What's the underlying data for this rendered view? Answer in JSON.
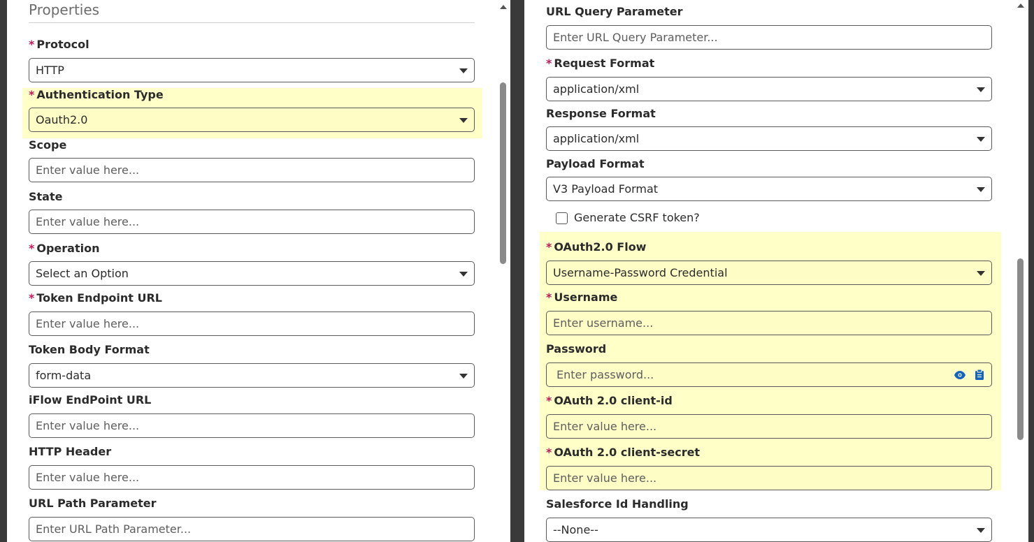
{
  "left": {
    "heading": "Properties",
    "protocol": {
      "label": "Protocol",
      "value": "HTTP"
    },
    "auth_type": {
      "label": "Authentication Type",
      "value": "Oauth2.0"
    },
    "scope": {
      "label": "Scope",
      "placeholder": "Enter value here..."
    },
    "state": {
      "label": "State",
      "placeholder": "Enter value here..."
    },
    "operation": {
      "label": "Operation",
      "value": "Select an Option"
    },
    "token_endpoint": {
      "label": "Token Endpoint URL",
      "placeholder": "Enter value here..."
    },
    "token_body_format": {
      "label": "Token Body Format",
      "value": "form-data"
    },
    "iflow_endpoint": {
      "label": "iFlow EndPoint URL",
      "placeholder": "Enter value here..."
    },
    "http_header": {
      "label": "HTTP Header",
      "placeholder": "Enter value here..."
    },
    "url_path_param": {
      "label": "URL Path Parameter",
      "placeholder": "Enter URL Path Parameter..."
    }
  },
  "right": {
    "url_query_param": {
      "label": "URL Query Parameter",
      "placeholder": "Enter URL Query Parameter..."
    },
    "request_format": {
      "label": "Request Format",
      "value": "application/xml"
    },
    "response_format": {
      "label": "Response Format",
      "value": "application/xml"
    },
    "payload_format": {
      "label": "Payload Format",
      "value": "V3 Payload Format"
    },
    "csrf": {
      "label": "Generate CSRF token?"
    },
    "oauth_flow": {
      "label": "OAuth2.0 Flow",
      "value": "Username-Password Credential"
    },
    "username": {
      "label": "Username",
      "placeholder": "Enter username..."
    },
    "password": {
      "label": "Password",
      "placeholder": "Enter password..."
    },
    "client_id": {
      "label": "OAuth 2.0 client-id",
      "placeholder": "Enter value here..."
    },
    "client_secret": {
      "label": "OAuth 2.0 client-secret",
      "placeholder": "Enter value here..."
    },
    "salesforce_id": {
      "label": "Salesforce Id Handling",
      "value": "--None--"
    }
  },
  "colors": {
    "highlight": "#ffffc8",
    "required": "#c2185b",
    "icon_blue": "#1565c0"
  },
  "icons": {
    "dropdown": "chevron-down-icon",
    "show_password": "eye-icon",
    "paste": "clipboard-icon"
  }
}
